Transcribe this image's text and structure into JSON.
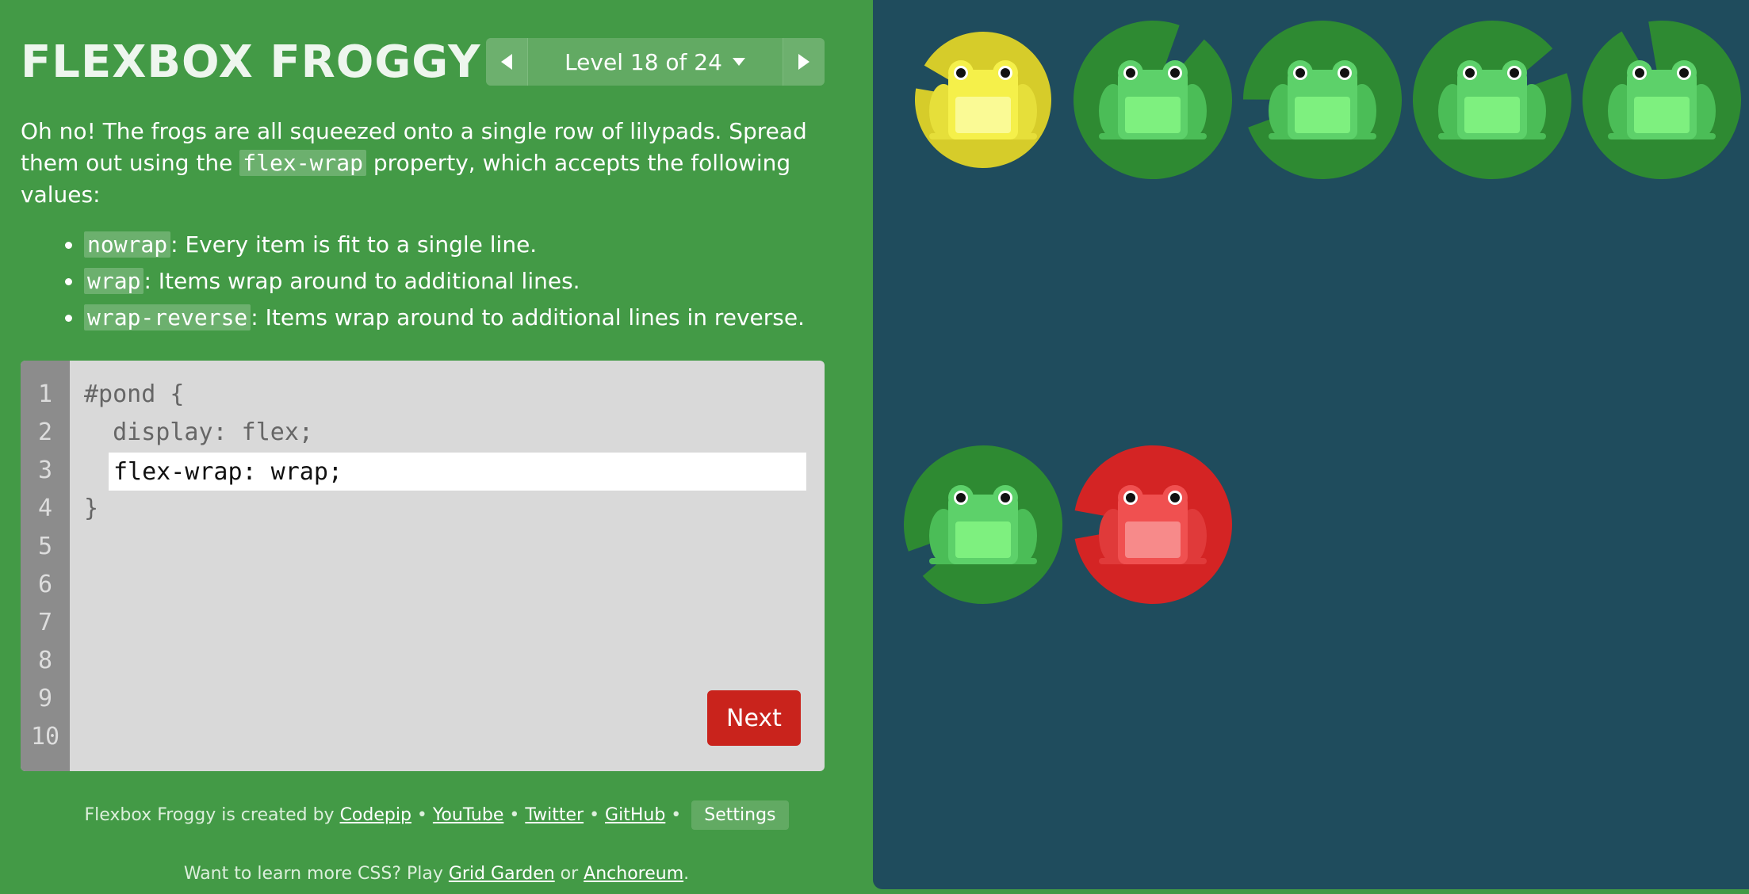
{
  "title": "FLEXBOX FROGGY",
  "level_nav": {
    "prev_icon": "triangle-left-icon",
    "label": "Level 18 of 24",
    "dropdown_icon": "caret-down-icon",
    "next_icon": "triangle-right-icon"
  },
  "instructions": {
    "intro_part1": "Oh no! The frogs are all squeezed onto a single row of lilypads. Spread them out using the ",
    "intro_code": "flex-wrap",
    "intro_part2": " property, which accepts the following values:",
    "values": [
      {
        "code": "nowrap",
        "desc": ": Every item is fit to a single line."
      },
      {
        "code": "wrap",
        "desc": ": Items wrap around to additional lines."
      },
      {
        "code": "wrap-reverse",
        "desc": ": Items wrap around to additional lines in reverse."
      }
    ]
  },
  "editor": {
    "line_numbers": [
      "1",
      "2",
      "3",
      "4",
      "5",
      "6",
      "7",
      "8",
      "9",
      "10"
    ],
    "line1": "#pond {",
    "line2": "  display: flex;",
    "input_value": "flex-wrap: wrap;",
    "line4": "}",
    "next_label": "Next"
  },
  "credits": {
    "prefix": "Flexbox Froggy is created by ",
    "links": [
      "Codepip",
      "YouTube",
      "Twitter",
      "GitHub"
    ],
    "separator": " • ",
    "settings_label": "Settings"
  },
  "more_css": {
    "prefix": "Want to learn more CSS? Play ",
    "link1": "Grid Garden",
    "middle": " or ",
    "link2": "Anchoreum",
    "suffix": "."
  },
  "colors": {
    "green_pad": "#2e8a32",
    "green_frog": "#5dd16a",
    "yellow_pad": "#d6cc2a",
    "yellow_frog": "#f5f04a",
    "red_pad": "#d42424",
    "red_frog": "#f05050",
    "pond": "#1f4c5d",
    "sidebar": "#439a46"
  },
  "pond": {
    "lilypads": [
      "yellow",
      "green",
      "green",
      "green",
      "green",
      "green",
      "red"
    ],
    "frogs": [
      "yellow",
      "green",
      "green",
      "green",
      "green",
      "green",
      "red"
    ]
  }
}
